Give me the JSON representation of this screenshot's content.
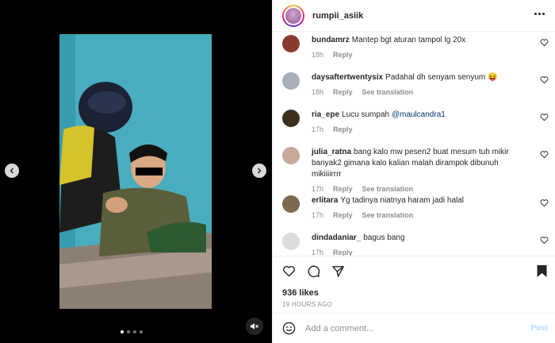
{
  "header": {
    "username": "rumpii_asiik"
  },
  "comments": [
    {
      "username": "bundamrz",
      "text": "Mantep bgt aturan tampol lg 20x",
      "time": "18h",
      "reply": "Reply",
      "translation": "",
      "avatar_color": "#8b3a2e"
    },
    {
      "username": "daysaftertwentysix",
      "text": "Padahal dh senyam senyum 😝",
      "time": "18h",
      "reply": "Reply",
      "translation": "See translation",
      "avatar_color": "#a7b0b8"
    },
    {
      "username": "ria_epe",
      "text": "Lucu sumpah",
      "mention": "@maulcandra1",
      "time": "17h",
      "reply": "Reply",
      "translation": "",
      "avatar_color": "#3d3020"
    },
    {
      "username": "julia_ratna",
      "text": "bang kalo mw pesen2 buat mesum tuh mikir banyak2 gimana kalo kalian malah dirampok dibunuh mikiiiirrrr",
      "time": "17h",
      "reply": "Reply",
      "translation": "See translation",
      "avatar_color": "#c7a89a"
    },
    {
      "username": "erlitara",
      "text": "Yg tadinya niatnya haram jadi halal",
      "time": "17h",
      "reply": "Reply",
      "translation": "See translation",
      "avatar_color": "#7d6a52"
    },
    {
      "username": "dindadaniar_",
      "text": "bagus bang",
      "time": "17h",
      "reply": "Reply",
      "translation": "",
      "avatar_color": "#dcdcdc"
    }
  ],
  "post": {
    "likes": "936 likes",
    "time_ago": "19 HOURS AGO"
  },
  "add_comment": {
    "placeholder": "Add a comment...",
    "post_label": "Post"
  },
  "icons": {
    "prev": "chevron-left-icon",
    "next": "chevron-right-icon",
    "mute": "speaker-muted-icon",
    "like": "heart-icon",
    "comment": "comment-icon",
    "share": "paper-plane-icon",
    "save": "bookmark-icon",
    "emoji": "smiley-icon",
    "more": "more-icon"
  },
  "carousel": {
    "slides": 4,
    "active_index": 0
  }
}
